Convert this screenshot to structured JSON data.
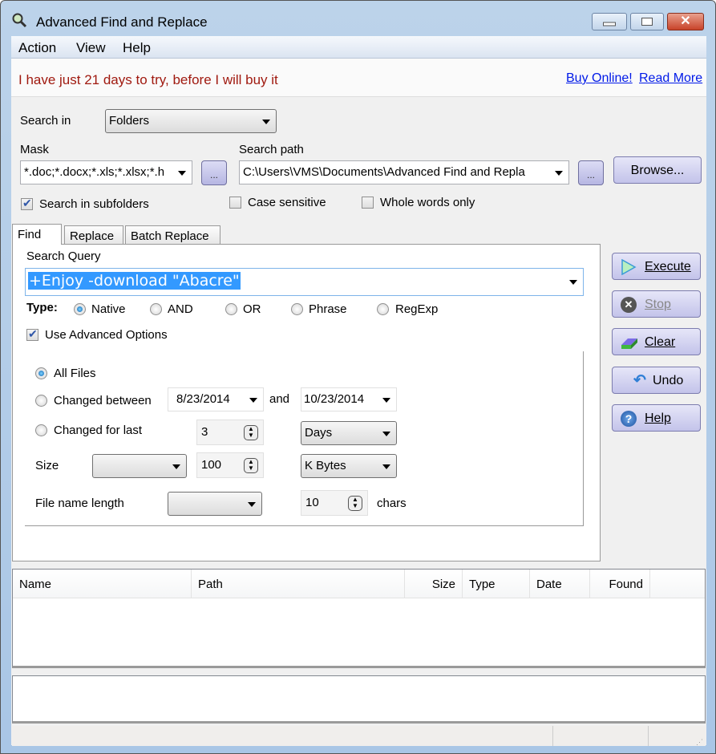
{
  "window": {
    "title": "Advanced Find and Replace"
  },
  "menu": [
    "Action",
    "View",
    "Help"
  ],
  "banner": {
    "text": "I have just 21 days to try, before I will buy it",
    "links": [
      "Buy Online!",
      "Read More"
    ],
    "text_color": "#a01a10",
    "link_color": "#0019e8"
  },
  "search_in": {
    "label": "Search in",
    "value": "Folders"
  },
  "mask": {
    "label": "Mask",
    "value": "*.doc;*.docx;*.xls;*.xlsx;*.h"
  },
  "search_path": {
    "label": "Search path",
    "value": "C:\\Users\\VMS\\Documents\\Advanced Find and Repla",
    "browse": "Browse..."
  },
  "ellipsis": "...",
  "options": {
    "subfolders": {
      "label": "Search in subfolders",
      "checked": true
    },
    "case_sensitive": {
      "label": "Case sensitive",
      "checked": false
    },
    "whole_words": {
      "label": "Whole words only",
      "checked": false
    }
  },
  "tabs": [
    "Find",
    "Replace",
    "Batch Replace"
  ],
  "find": {
    "query_label": "Search Query",
    "query": "+Enjoy -download \"Abacre\"",
    "type_label": "Type:",
    "types": [
      "Native",
      "AND",
      "OR",
      "Phrase",
      "RegExp"
    ],
    "selected_type": "Native",
    "advanced": {
      "label": "Use Advanced Options",
      "checked": true
    },
    "filters": {
      "all_files": "All Files",
      "changed_between": "Changed between",
      "date_from": "8/23/2014",
      "and": "and",
      "date_to": "10/23/2014",
      "changed_for_last": "Changed for last",
      "last_value": "3",
      "last_unit": "Days",
      "size_label": "Size",
      "size_op": "",
      "size_value": "100",
      "size_unit": "K Bytes",
      "fname_label": "File name length",
      "fname_op": "",
      "fname_value": "10",
      "fname_unit": "chars",
      "selected": "All Files"
    }
  },
  "actions": {
    "execute": "Execute",
    "stop": "Stop",
    "clear": "Clear",
    "undo": "Undo",
    "help": "Help"
  },
  "results": {
    "columns": [
      "Name",
      "Path",
      "Size",
      "Type",
      "Date",
      "Found"
    ],
    "rows": []
  }
}
